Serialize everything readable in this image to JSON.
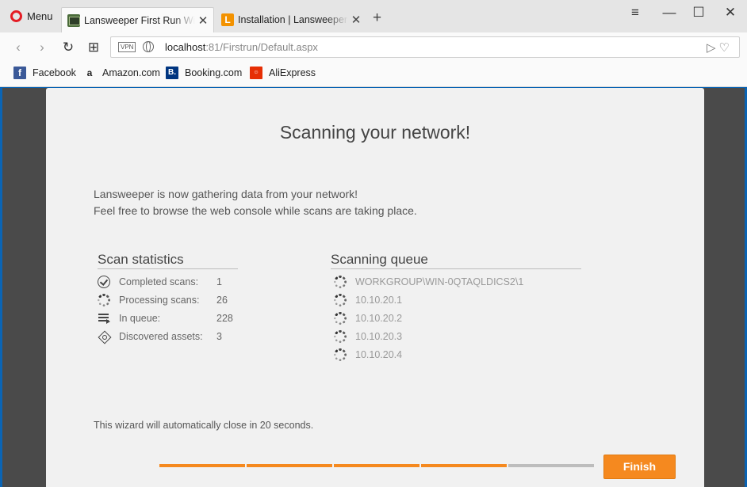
{
  "browser": {
    "menu_label": "Menu",
    "tabs": [
      {
        "title": "Lansweeper First Run Wizard",
        "active": true,
        "favicon": "lansweeper-icon"
      },
      {
        "title": "Installation | Lansweeper IT Asset Management",
        "active": false,
        "favicon": "L"
      }
    ],
    "favicon_letter": "L",
    "address": {
      "vpn": "VPN",
      "host": "localhost",
      "rest": ":81/Firstrun/Default.aspx"
    },
    "bookmarks": [
      {
        "label": "Facebook",
        "icon": "f",
        "color": "#3b5998"
      },
      {
        "label": "Amazon.com",
        "icon": "a",
        "color": "#222222"
      },
      {
        "label": "Booking.com",
        "icon": "B.",
        "color": "#003580"
      },
      {
        "label": "AliExpress",
        "icon": "ali",
        "color": "#e62e04"
      }
    ]
  },
  "page": {
    "heading": "Scanning your network!",
    "intro_line1": "Lansweeper is now gathering data from your network!",
    "intro_line2": "Feel free to browse the web console while scans are taking place.",
    "stats": {
      "title": "Scan statistics",
      "rows": [
        {
          "label": "Completed scans:",
          "value": "1",
          "icon": "check-circle-icon"
        },
        {
          "label": "Processing scans:",
          "value": "26",
          "icon": "spinner-icon"
        },
        {
          "label": "In queue:",
          "value": "228",
          "icon": "queue-list-icon"
        },
        {
          "label": "Discovered assets:",
          "value": "3",
          "icon": "asset-diamond-icon"
        }
      ]
    },
    "queue": {
      "title": "Scanning queue",
      "items": [
        "WORKGROUP\\WIN-0QTAQLDICS2\\1",
        "10.10.20.1",
        "10.10.20.2",
        "10.10.20.3",
        "10.10.20.4"
      ]
    },
    "autoclose": "This wizard will automatically close in 20 seconds.",
    "wizard_progress": {
      "steps_total": 5,
      "steps_completed": 4
    },
    "finish_label": "Finish"
  },
  "colors": {
    "accent": "#f5891f",
    "page_bg": "#f1f1f1",
    "frame_bg": "#4a4a4a"
  }
}
